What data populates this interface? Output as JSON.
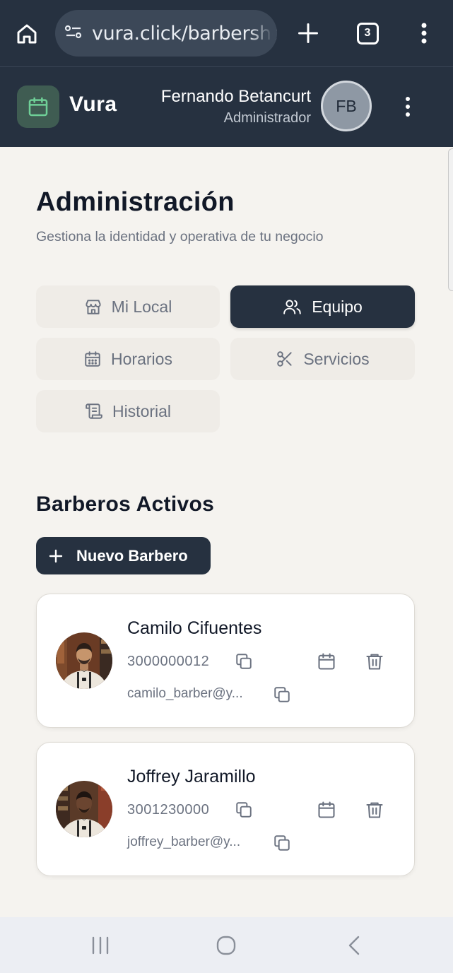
{
  "browser": {
    "url": "vura.click/barbershop",
    "tab_count": "3"
  },
  "app": {
    "brand": "Vura",
    "user": {
      "name": "Fernando Betancurt",
      "role": "Administrador",
      "initials": "FB"
    }
  },
  "page": {
    "title": "Administración",
    "subtitle": "Gestiona la identidad y operativa de tu negocio"
  },
  "tabs": [
    {
      "label": "Mi Local",
      "icon": "store-icon",
      "active": false
    },
    {
      "label": "Equipo",
      "icon": "users-icon",
      "active": true
    },
    {
      "label": "Horarios",
      "icon": "calendar-icon",
      "active": false
    },
    {
      "label": "Servicios",
      "icon": "scissors-icon",
      "active": false
    },
    {
      "label": "Historial",
      "icon": "scroll-icon",
      "active": false
    }
  ],
  "section": {
    "title": "Barberos Activos",
    "new_button": "Nuevo Barbero"
  },
  "barbers": [
    {
      "name": "Camilo Cifuentes",
      "phone": "3000000012",
      "email": "camilo_barber@y..."
    },
    {
      "name": "Joffrey Jaramillo",
      "phone": "3001230000",
      "email": "joffrey_barber@y..."
    }
  ],
  "colors": {
    "dark": "#263140",
    "background": "#f5f3ef",
    "tab_inactive": "#efece7",
    "logo_accent": "#6fcf97"
  }
}
